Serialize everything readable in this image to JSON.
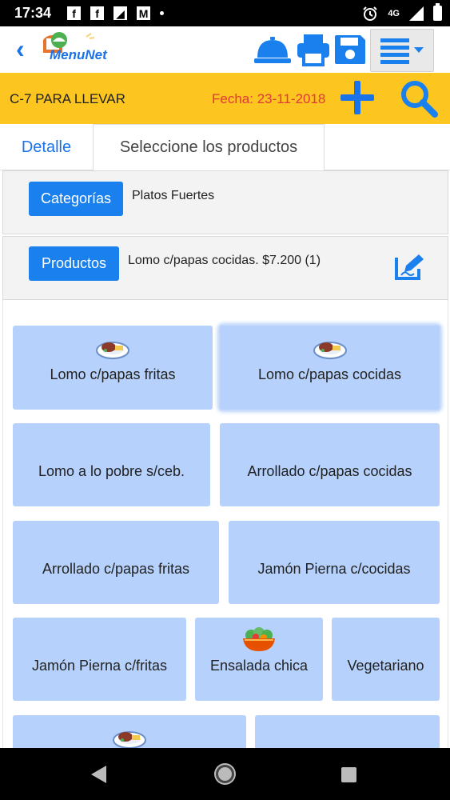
{
  "status_bar": {
    "time": "17:34",
    "network": "4G"
  },
  "app": {
    "logo_text": "MenuNet"
  },
  "order": {
    "title": "C-7 PARA LLEVAR",
    "date": "Fecha: 23-11-2018"
  },
  "tabs": [
    {
      "label": "Detalle"
    },
    {
      "label": "Seleccione los productos"
    }
  ],
  "category": {
    "button_label": "Categorías",
    "selected": "Platos Fuertes"
  },
  "product": {
    "button_label": "Productos",
    "selected": "Lomo c/papas cocidas. $7.200 (1)"
  },
  "products": [
    {
      "name": "Lomo c/papas fritas",
      "icon": "dish-icon"
    },
    {
      "name": "Lomo c/papas cocidas",
      "icon": "dish-icon"
    },
    {
      "name": "Lomo a lo pobre s/ceb.",
      "icon": ""
    },
    {
      "name": "Arrollado c/papas cocidas",
      "icon": ""
    },
    {
      "name": "Arrollado c/papas fritas",
      "icon": ""
    },
    {
      "name": "Jamón Pierna c/cocidas",
      "icon": ""
    },
    {
      "name": "Jamón Pierna c/fritas",
      "icon": ""
    },
    {
      "name": "Ensalada chica",
      "icon": "salad-icon"
    },
    {
      "name": "Vegetariano",
      "icon": ""
    },
    {
      "name": "",
      "icon": "dish-icon"
    },
    {
      "name": "",
      "icon": ""
    }
  ],
  "colors": {
    "accent_blue": "#1a80ee",
    "order_bar_yellow": "#fcc51f",
    "date_red": "#e03a3a",
    "card_blue": "#b6d1fb"
  }
}
